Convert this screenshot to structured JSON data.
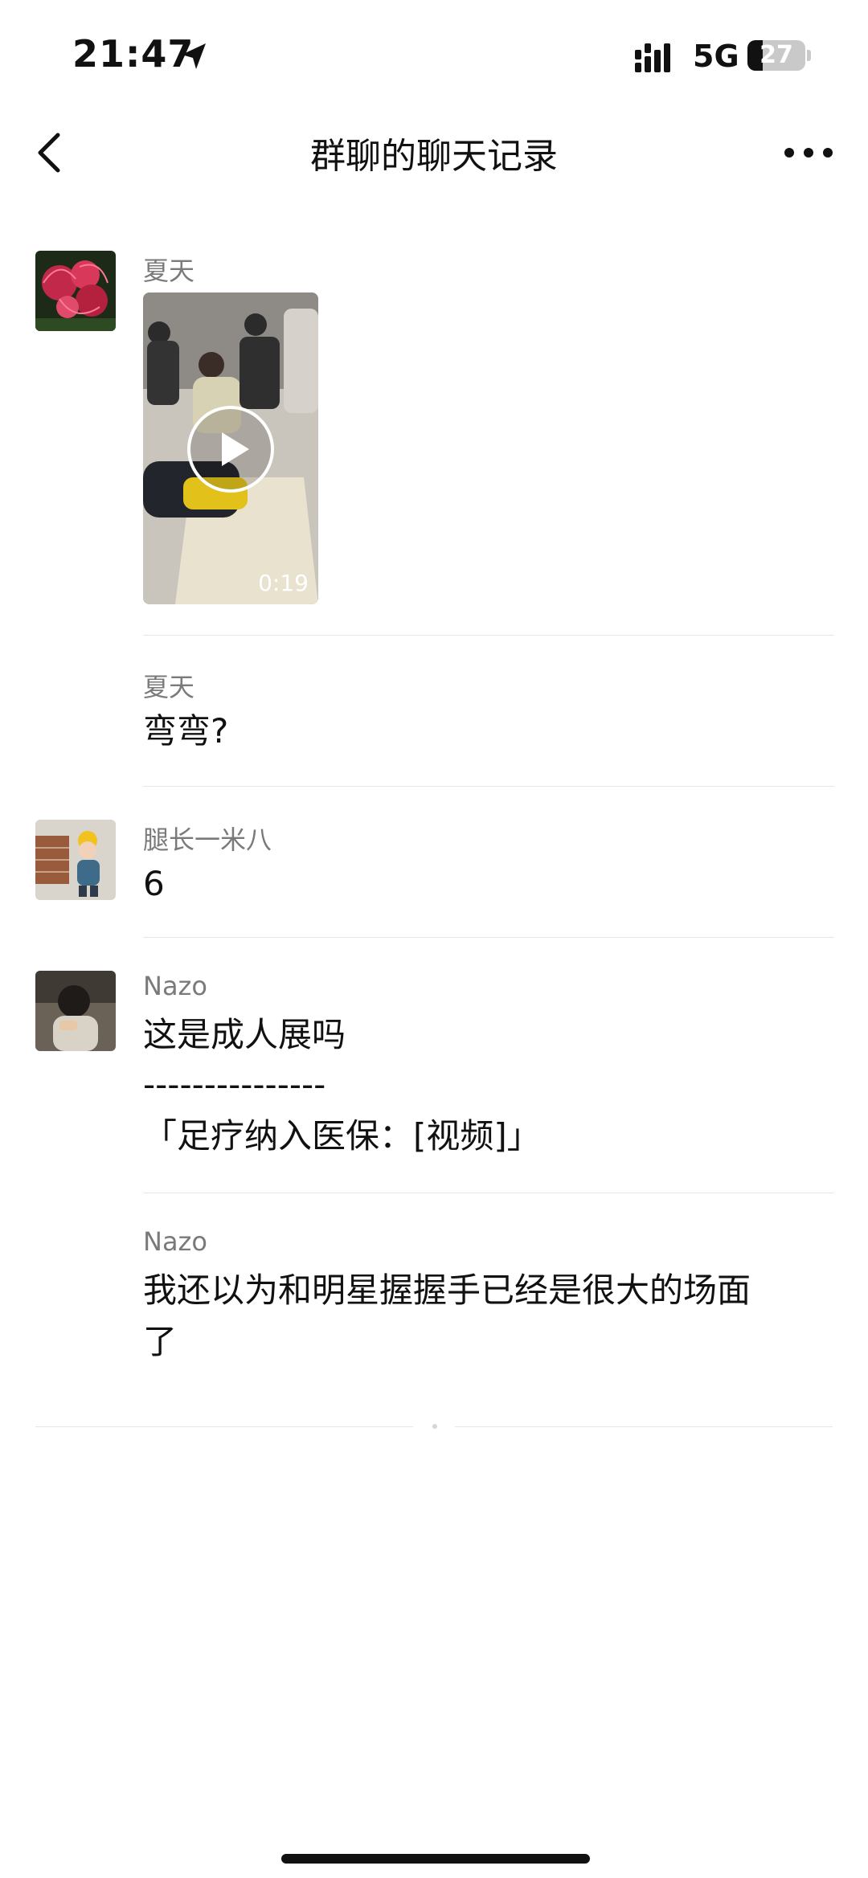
{
  "status_bar": {
    "time": "21:47",
    "network": "5G",
    "battery": "27",
    "battery_level_percent": 27
  },
  "nav": {
    "title": "群聊的聊天记录",
    "back_icon": "chevron-left-icon",
    "more_icon": "more-dots-icon"
  },
  "messages": [
    {
      "sender": "夏天",
      "type": "video",
      "duration": "0:19"
    },
    {
      "sender": "夏天",
      "text": "弯弯?"
    },
    {
      "sender": "腿长一米八",
      "text": "6"
    },
    {
      "sender": "Nazo",
      "lines": [
        "这是成人展吗",
        "---------------",
        "「足疗纳入医保：[视频]」"
      ]
    },
    {
      "sender": "Nazo",
      "lines": [
        "我还以为和明星握握手已经是很大的场面",
        "了"
      ]
    }
  ],
  "colors": {
    "sender_gray": "#7a7a7a",
    "divider": "#e6e6e6",
    "text": "#111111"
  }
}
